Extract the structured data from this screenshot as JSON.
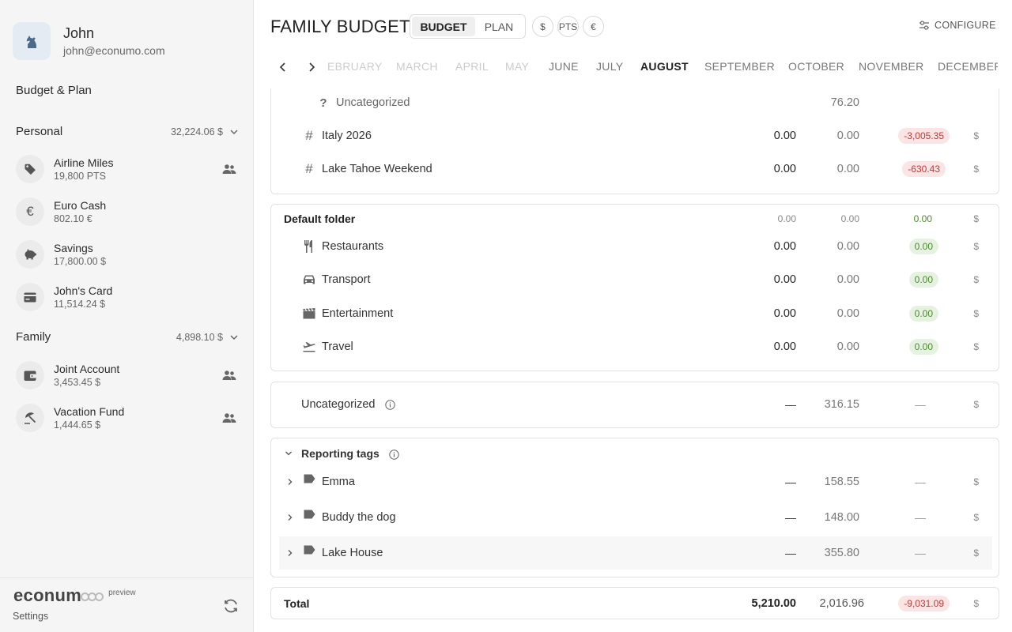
{
  "user": {
    "name": "John",
    "email": "john@econumo.com"
  },
  "sidebar": {
    "budget_plan_label": "Budget & Plan",
    "groups": [
      {
        "name": "Personal",
        "total": "32,224.06 $",
        "accounts": [
          {
            "name": "Airline Miles",
            "balance": "19,800 PTS",
            "icon": "tag-icon",
            "shared": true
          },
          {
            "name": "Euro Cash",
            "balance": "802.10 €",
            "icon": "euro-icon",
            "shared": false
          },
          {
            "name": "Savings",
            "balance": "17,800.00 $",
            "icon": "piggy-bank-icon",
            "shared": false
          },
          {
            "name": "John's Card",
            "balance": "11,514.24 $",
            "icon": "credit-card-icon",
            "shared": false
          }
        ]
      },
      {
        "name": "Family",
        "total": "4,898.10 $",
        "accounts": [
          {
            "name": "Joint Account",
            "balance": "3,453.45 $",
            "icon": "wallet-icon",
            "shared": true
          },
          {
            "name": "Vacation Fund",
            "balance": "1,444.65 $",
            "icon": "beach-umbrella-icon",
            "shared": true
          }
        ]
      }
    ],
    "footer": {
      "logo": "econum",
      "preview": "preview",
      "settings": "Settings"
    }
  },
  "header": {
    "title": "FAMILY BUDGET",
    "modes": [
      "BUDGET",
      "PLAN"
    ],
    "active_mode": "BUDGET",
    "currencies": [
      "$",
      "PTS",
      "€"
    ],
    "configure": "CONFIGURE"
  },
  "months": {
    "faded": [
      "EBRUARY",
      "MARCH",
      "APRIL",
      "MAY"
    ],
    "visible": [
      "JUNE",
      "JULY",
      "AUGUST",
      "SEPTEMBER",
      "OCTOBER",
      "NOVEMBER",
      "DECEMBER"
    ],
    "current": "AUGUST"
  },
  "tags_card": {
    "rows": [
      {
        "label": "Uncategorized",
        "icon": "question-icon",
        "spent": "76.20"
      },
      {
        "label": "Italy 2026",
        "icon": "hash-icon",
        "budget": "0.00",
        "spent": "0.00",
        "available": "-3,005.35",
        "currency": "$"
      },
      {
        "label": "Lake Tahoe Weekend",
        "icon": "hash-icon",
        "budget": "0.00",
        "spent": "0.00",
        "available": "-630.43",
        "currency": "$"
      }
    ]
  },
  "default_folder": {
    "title": "Default folder",
    "budget": "0.00",
    "spent": "0.00",
    "available": "0.00",
    "currency": "$",
    "rows": [
      {
        "label": "Restaurants",
        "icon": "fork-knife-icon",
        "budget": "0.00",
        "spent": "0.00",
        "available": "0.00",
        "currency": "$"
      },
      {
        "label": "Transport",
        "icon": "car-icon",
        "budget": "0.00",
        "spent": "0.00",
        "available": "0.00",
        "currency": "$"
      },
      {
        "label": "Entertainment",
        "icon": "film-icon",
        "budget": "0.00",
        "spent": "0.00",
        "available": "0.00",
        "currency": "$"
      },
      {
        "label": "Travel",
        "icon": "plane-icon",
        "budget": "0.00",
        "spent": "0.00",
        "available": "0.00",
        "currency": "$"
      }
    ]
  },
  "uncategorized": {
    "label": "Uncategorized",
    "budget": "—",
    "spent": "316.15",
    "available": "—",
    "currency": "$"
  },
  "reporting_tags": {
    "title": "Reporting tags",
    "rows": [
      {
        "label": "Emma",
        "budget": "—",
        "spent": "158.55",
        "available": "—",
        "currency": "$"
      },
      {
        "label": "Buddy the dog",
        "budget": "—",
        "spent": "148.00",
        "available": "—",
        "currency": "$"
      },
      {
        "label": "Lake House",
        "budget": "—",
        "spent": "355.80",
        "available": "—",
        "currency": "$"
      }
    ]
  },
  "total": {
    "label": "Total",
    "budget": "5,210.00",
    "spent": "2,016.96",
    "available": "-9,031.09",
    "currency": "$"
  },
  "colors": {
    "negative": "#c23a3a",
    "positive": "#4a8a2e",
    "accent": "#4a6a8c"
  }
}
